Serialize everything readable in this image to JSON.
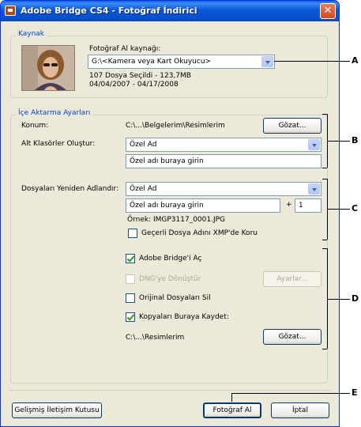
{
  "window": {
    "title": "Adobe Bridge CS4 - Fotoğraf İndirici"
  },
  "source_group": {
    "label": "Kaynak",
    "get_from_label": "Fotoğraf Al kaynağı:",
    "source_select": "G:\\<Kamera veya Kart Okuyucu>",
    "file_summary": "107 Dosya Seçildi - 123,7MB",
    "date_range": "04/04/2007 - 04/17/2008"
  },
  "import_group": {
    "label": "İçe Aktarma Ayarları",
    "location_label": "Konum:",
    "location_path": "C:\\...\\Belgelerim\\Resimlerim",
    "browse_label": "Gözat...",
    "subfolders_label": "Alt Klasörler Oluştur:",
    "subfolders_value": "Özel Ad",
    "subfolder_name_value": "Özel adı buraya girin",
    "rename_label": "Dosyaları Yeniden Adlandır:",
    "rename_value": "Özel Ad",
    "rename_name_value": "Özel adı buraya girin",
    "plus": "+",
    "start_number": "1",
    "example": "Örnek: IMGP3117_0001.JPG",
    "preserve_xmp": "Geçerli Dosya Adını XMP'de Koru",
    "open_bridge": "Adobe Bridge'i Aç",
    "convert_dng": "DNG'ye Dönüştür",
    "settings_label": "Ayarlar...",
    "delete_originals": "Orijinal Dosyaları Sil",
    "save_copies": "Kopyaları Buraya Kaydet:",
    "copies_path": "C:\\...\\Resimlerim",
    "browse2_label": "Gözat..."
  },
  "footer": {
    "advanced_label": "Gelişmiş İletişim Kutusu",
    "get_photos_label": "Fotoğraf Al",
    "cancel_label": "İptal"
  },
  "callouts": {
    "a": "A",
    "b": "B",
    "c": "C",
    "d": "D",
    "e": "E"
  }
}
